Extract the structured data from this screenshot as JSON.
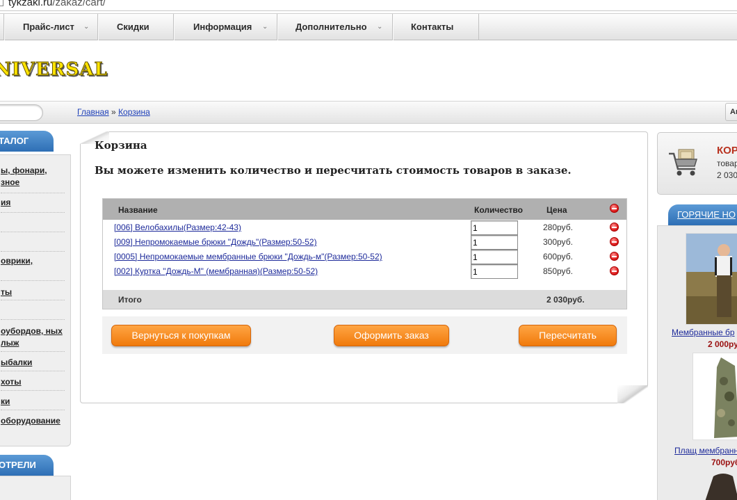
{
  "browser": {
    "url_host": "tykzaki.ru",
    "url_path": "/zakaz/cart/"
  },
  "nav": {
    "items": [
      {
        "label": "Прайс-лист",
        "has_dropdown": true
      },
      {
        "label": "Скидки",
        "has_dropdown": false
      },
      {
        "label": "Информация",
        "has_dropdown": true
      },
      {
        "label": "Дополнительно",
        "has_dropdown": true
      },
      {
        "label": "Контакты",
        "has_dropdown": false
      }
    ]
  },
  "header": {
    "logo_text": "NIVERSAL"
  },
  "breadcrumb": {
    "home": "Главная",
    "sep": "»",
    "current": "Корзина"
  },
  "auth": {
    "button_label": "Ак"
  },
  "left_sidebar": {
    "catalog_title": "ТАЛОГ",
    "items": [
      {
        "text": "ы, фонари, зное"
      },
      {
        "text": "ия"
      },
      {
        "text": ""
      },
      {
        "text": ""
      },
      {
        "text": "оврики,"
      },
      {
        "text": "ты"
      },
      {
        "text": ""
      },
      {
        "text": "оубордов, ных лыж"
      },
      {
        "text": "ыбалки"
      },
      {
        "text": "хоты"
      },
      {
        "text": "ки"
      },
      {
        "text": "оборудование"
      }
    ],
    "viewed_title": "ОТРЕЛИ"
  },
  "cart": {
    "title": "Корзина",
    "subtitle": "Вы можете изменить количество и пересчитать стоимость товаров в заказе.",
    "columns": {
      "name": "Название",
      "qty": "Количество",
      "price": "Цена"
    },
    "rows": [
      {
        "name": "[006] Велобахилы(Размер:42-43)",
        "qty": "1",
        "price": "280руб."
      },
      {
        "name": "[009] Непромокаемые брюки \"Дождь\"(Размер:50-52)",
        "qty": "1",
        "price": "300руб."
      },
      {
        "name": "[0005] Непромокаемые мембранные брюки \"Дождь-м\"(Размер:50-52)",
        "qty": "1",
        "price": "600руб."
      },
      {
        "name": "[002] Куртка \"Дождь-М\" (мембранная)(Размер:50-52)",
        "qty": "1",
        "price": "850руб."
      }
    ],
    "total_label": "Итого",
    "total_value": "2 030руб.",
    "buttons": {
      "back": "Вернуться к покупкам",
      "checkout": "Оформить заказ",
      "recalc": "Пересчитать"
    }
  },
  "mini_cart": {
    "title": "КОР",
    "items_text": "товар",
    "total": "2 030"
  },
  "hot": {
    "title": "ГОРЯЧИЕ НО",
    "products": [
      {
        "name": "Мембранные бр",
        "price": "2 000ру"
      },
      {
        "name": "Плащ мембранн",
        "price": "700руб"
      }
    ]
  }
}
